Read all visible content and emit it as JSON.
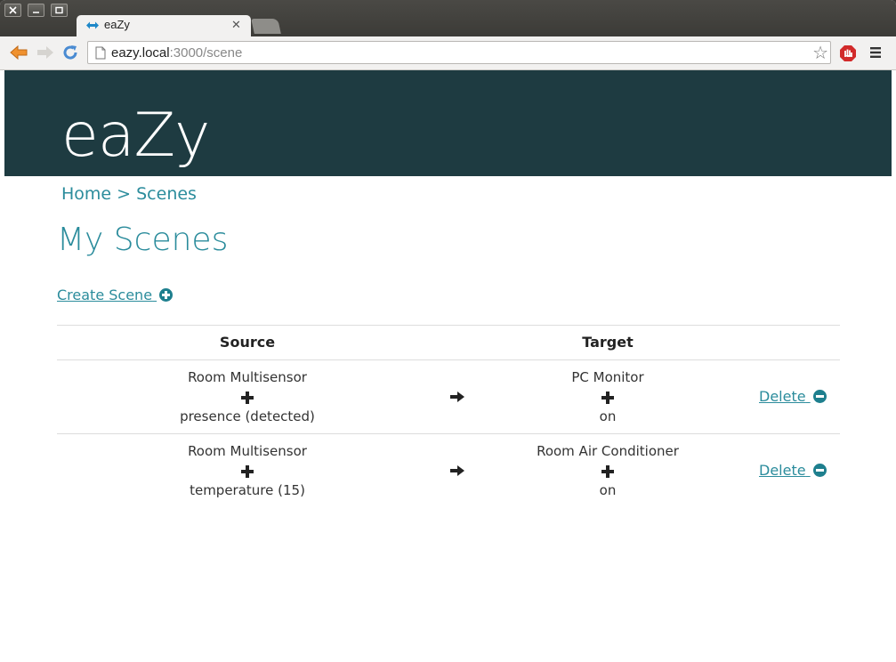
{
  "browser": {
    "tab_title": "eaZy",
    "url_host": "eazy.local",
    "url_rest": ":3000/scene"
  },
  "site": {
    "brand": "eaZy"
  },
  "breadcrumb": {
    "home": "Home",
    "separator": ">",
    "current": "Scenes"
  },
  "page": {
    "title": "My Scenes",
    "create_label": "Create Scene"
  },
  "table": {
    "headers": {
      "source": "Source",
      "target": "Target"
    },
    "rows": [
      {
        "source_device": "Room Multisensor",
        "source_state": "presence (detected)",
        "target_device": "PC Monitor",
        "target_state": "on",
        "delete_label": "Delete"
      },
      {
        "source_device": "Room Multisensor",
        "source_state": "temperature (15)",
        "target_device": "Room Air Conditioner",
        "target_state": "on",
        "delete_label": "Delete"
      }
    ]
  },
  "colors": {
    "accent": "#2b8c9c",
    "hero_bg": "#1e3b41"
  }
}
